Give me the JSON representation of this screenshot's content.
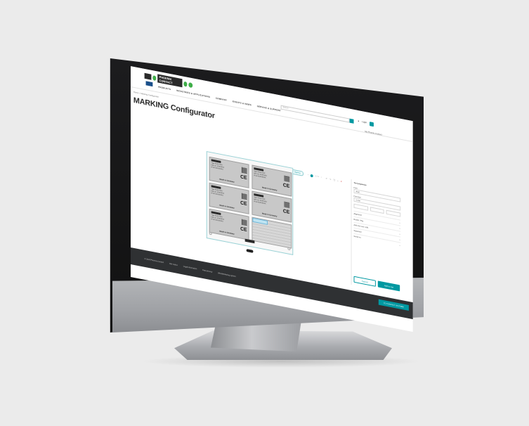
{
  "header": {
    "brand_wordmark": "PHOENIX CONTACT",
    "nav": [
      "PRODUCTS",
      "INDUSTRIES & APPLICATIONS",
      "COMPANY",
      "EVENTS & NEWS",
      "SERVICE & SUPPORT"
    ],
    "search_placeholder": "Search",
    "login_label": "Login",
    "account_link": "My Phoenix Contact"
  },
  "breadcrumb": "Home > Marking Configurator",
  "page": {
    "title": "MARKING Configurator"
  },
  "toolbar": {
    "tag_label": "Label material: Signing",
    "pager_label": "1 / 1"
  },
  "label_template": {
    "made_in": "Made in Germany",
    "ce": "CE",
    "rows": [
      "Type    XXXX-XXX",
      "Item no.    XXXXXXX",
      "IP 20    XXXXXXXX"
    ]
  },
  "panel": {
    "title": "Text properties",
    "font_label": "Font",
    "font_value": "Arial",
    "size_label": "Font size",
    "size_value": "2 mm",
    "sections": [
      "Alignment",
      "Rotate / Flip",
      "Add text over cells",
      "Separator",
      "Serial no."
    ],
    "cancel_button": "Cancel",
    "add_to_cart_button": "Add to cart"
  },
  "footer": {
    "links": [
      "© 2024 Phoenix Contact",
      "Site notice",
      "Legal information",
      "Data privacy",
      "Whistleblowing system"
    ],
    "cta": "TO CONTACT US FORM"
  },
  "colors": {
    "accent": "#0098a1",
    "logo_green": "#3fae49",
    "footer": "#2f3133"
  }
}
